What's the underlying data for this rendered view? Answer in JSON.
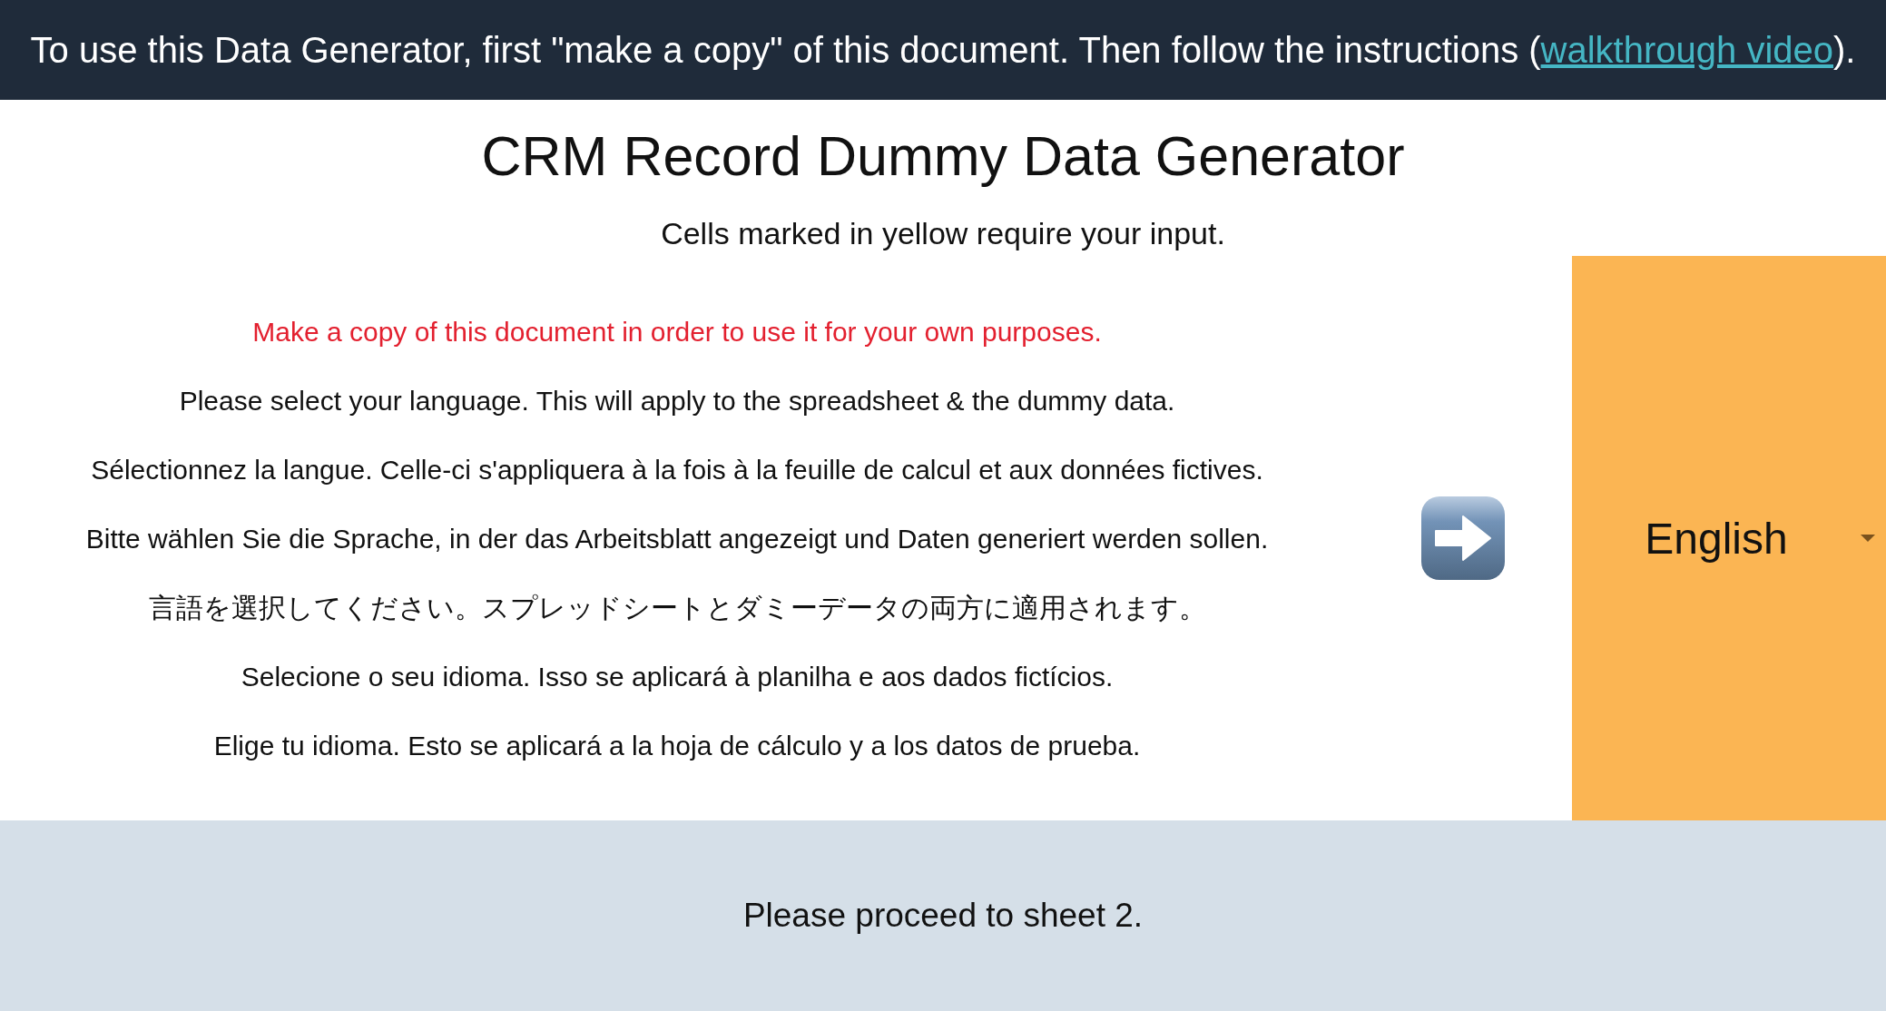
{
  "banner": {
    "text_before": "To use this Data Generator, first \"make a copy\" of this document. Then follow the instructions (",
    "link": "walkthrough video",
    "text_after": ")."
  },
  "title": "CRM Record Dummy Data Generator",
  "subtitle": "Cells marked in yellow require your input.",
  "instructions": [
    {
      "kind": "warning",
      "text": "Make a copy of this document in order to use it for your own purposes."
    },
    {
      "kind": "text",
      "text": "Please select your language. This will apply to the spreadsheet & the dummy data."
    },
    {
      "kind": "text",
      "text": "Sélectionnez la langue. Celle-ci s'appliquera à la fois à la feuille de calcul et aux données fictives."
    },
    {
      "kind": "text",
      "text": "Bitte wählen Sie die Sprache, in der das Arbeitsblatt angezeigt und Daten generiert werden sollen."
    },
    {
      "kind": "text",
      "text": "言語を選択してください。スプレッドシートとダミーデータの両方に適用されます。"
    },
    {
      "kind": "text",
      "text": "Selecione o seu idioma. Isso se aplicará à planilha e aos dados fictícios."
    },
    {
      "kind": "text",
      "text": "Elige tu idioma. Esto se aplicará a la hoja de cálculo y a los datos de prueba."
    }
  ],
  "language_select": {
    "value": "English"
  },
  "footer": {
    "text": "Please proceed to sheet 2."
  }
}
